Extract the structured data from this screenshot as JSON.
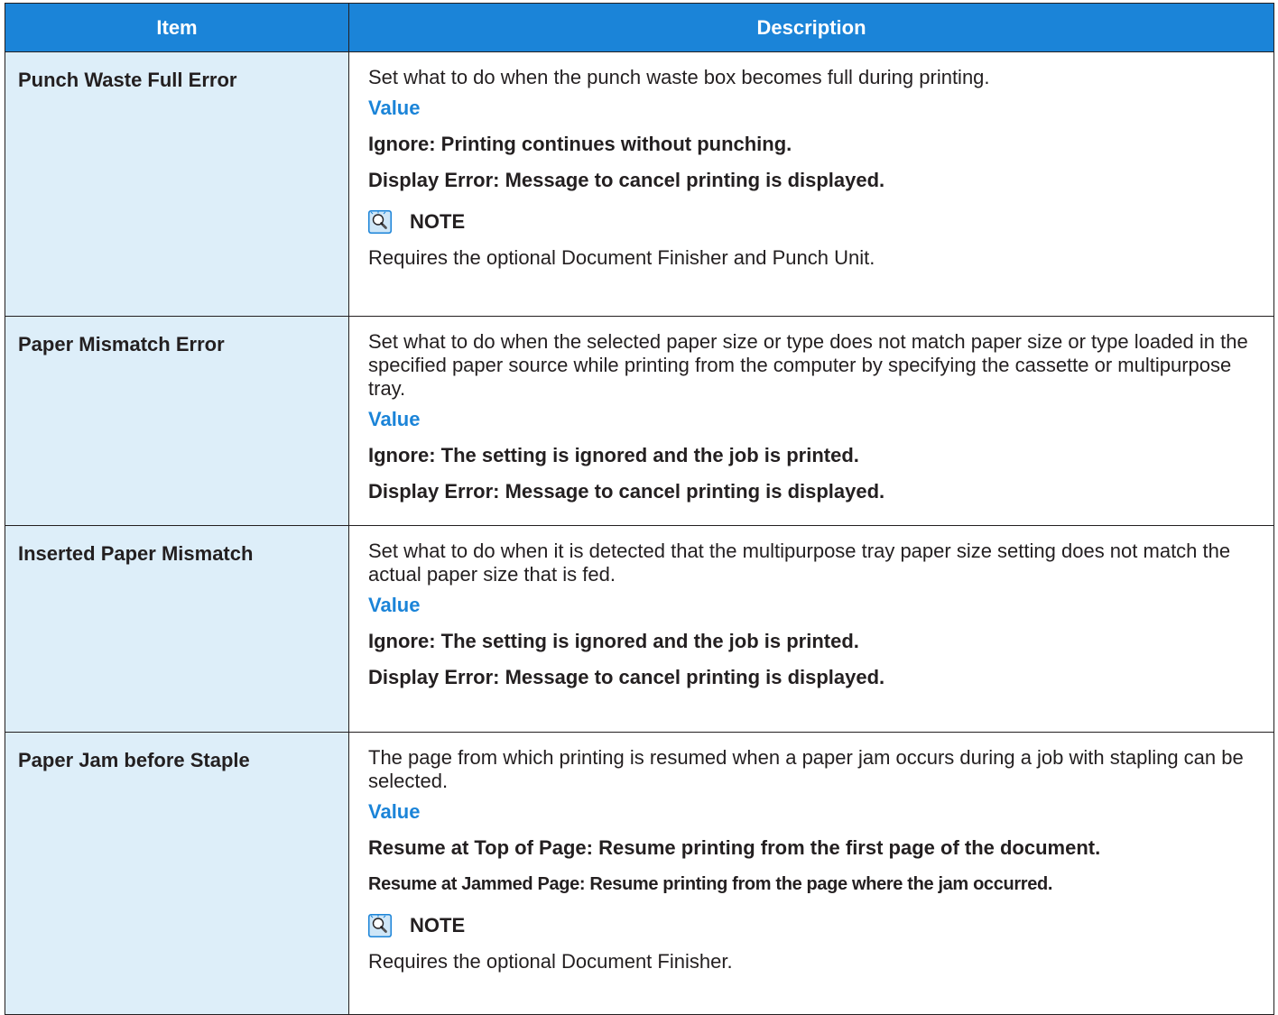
{
  "table": {
    "headers": {
      "item": "Item",
      "description": "Description"
    },
    "rows": [
      {
        "item": "Punch Waste Full Error",
        "description": "Set what to do when the punch waste box becomes full during printing.",
        "value_label": "Value",
        "options": [
          "Ignore: Printing continues without punching.",
          "Display Error: Message to cancel printing is displayed."
        ],
        "note_label": "NOTE",
        "note_text": "Requires the optional Document Finisher and Punch Unit."
      },
      {
        "item": "Paper Mismatch Error",
        "description": "Set what to do when the selected paper size or type does not match paper size or type loaded in the specified paper source while printing from the computer by specifying the cassette or multipurpose tray.",
        "value_label": "Value",
        "options": [
          "Ignore: The setting is ignored and the job is printed.",
          "Display Error: Message to cancel printing is displayed."
        ]
      },
      {
        "item": "Inserted Paper Mismatch",
        "description": "Set what to do when it is detected that the multipurpose tray paper size setting does not match the actual paper size that is fed.",
        "value_label": "Value",
        "options": [
          "Ignore: The setting is ignored and the job is printed.",
          "Display Error: Message to cancel printing is displayed."
        ]
      },
      {
        "item": "Paper Jam before Staple",
        "description": "The page from which printing is resumed when a paper jam occurs during a job with stapling can be selected.",
        "value_label": "Value",
        "options": [
          "Resume at Top of Page: Resume printing from the first page of the document.",
          "Resume at Jammed Page: Resume printing from the page where the jam occurred."
        ],
        "note_label": "NOTE",
        "note_text": "Requires the optional Document Finisher."
      }
    ]
  },
  "colors": {
    "header_bg": "#1b84d8",
    "item_bg": "#ddeef9",
    "value_label": "#1b84d8",
    "border": "#231f20"
  },
  "icons": {
    "note": "note-lightbulb-icon"
  }
}
